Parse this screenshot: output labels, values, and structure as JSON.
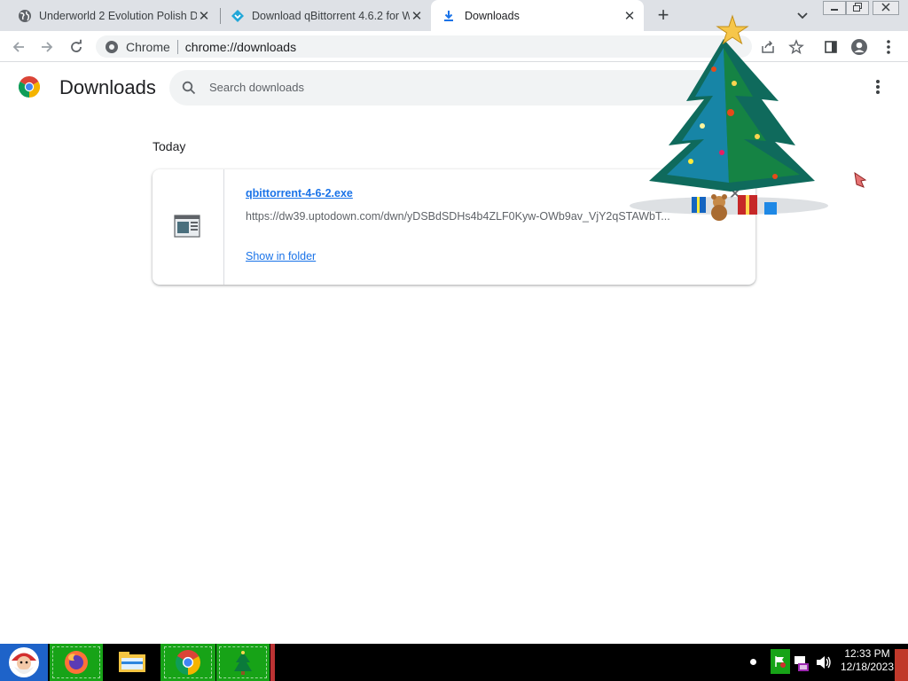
{
  "browser": {
    "tabs": [
      {
        "title": "Underworld 2 Evolution Polish D",
        "icon": "globe-icon",
        "active": false
      },
      {
        "title": "Download qBittorrent 4.6.2 for W",
        "icon": "uptodown-icon",
        "active": false
      },
      {
        "title": "Downloads",
        "icon": "download-icon",
        "active": true
      }
    ],
    "new_tab_label": "+",
    "omnibox": {
      "site_label": "Chrome",
      "url": "chrome://downloads"
    }
  },
  "page": {
    "title": "Downloads",
    "search_placeholder": "Search downloads",
    "section_label": "Today",
    "downloads": [
      {
        "filename": "qbittorrent-4-6-2.exe",
        "url": "https://dw39.uptodown.com/dwn/yDSBdSDHs4b4ZLF0Kyw-OWb9av_VjY2qSTAWbT...",
        "action_label": "Show in folder"
      }
    ]
  },
  "taskbar": {
    "time": "12:33 PM",
    "date": "12/18/2023"
  },
  "colors": {
    "accent": "#1a73e8",
    "tabstrip": "#dee1e6",
    "taskbar": "#000000",
    "taskbar_button": "#17a317"
  }
}
